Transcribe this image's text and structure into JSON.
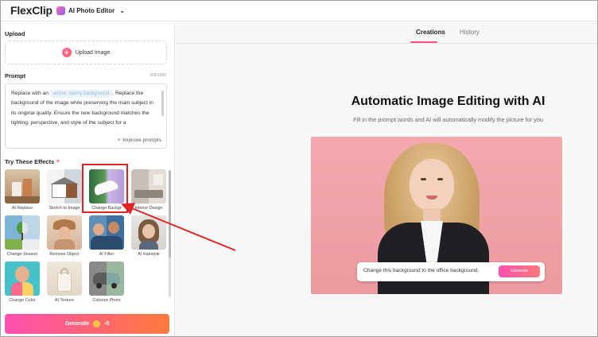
{
  "header": {
    "logo": "FlexClip",
    "tool": "AI Photo Editor"
  },
  "left": {
    "upload_title": "Upload",
    "upload_button": "Upload Image",
    "prompt_title": "Prompt",
    "prompt_counter": "308/1000",
    "prompt_text_before": "Replace with an",
    "prompt_chip": "active, sporty background",
    "prompt_text_after": ". Replace the background of the image while preserving the main subject in its original quality. Ensure the new background matches the lighting, perspective, and style of the subject for a",
    "improve_label": "Improve prompts",
    "effects_title": "Try These Effects",
    "effects": [
      {
        "label": "AI Replace"
      },
      {
        "label": "Sketch to Image"
      },
      {
        "label": "Change Backgr"
      },
      {
        "label": "Interior Design"
      },
      {
        "label": "Change Season"
      },
      {
        "label": "Remove Object"
      },
      {
        "label": "AI Filter"
      },
      {
        "label": "AI Hairstyle"
      },
      {
        "label": "Change Color"
      },
      {
        "label": "AI Texture"
      },
      {
        "label": "Colorize Photo"
      }
    ],
    "generate_label": "Generate",
    "generate_cost": "-5"
  },
  "main": {
    "tabs": [
      {
        "label": "Creations",
        "active": true
      },
      {
        "label": "History",
        "active": false
      }
    ],
    "headline": "Automatic Image Editing with AI",
    "subline": "Fill in the prompt words and AI will automatically modify the picture for you",
    "prompt_pill": "Change this background to the office background.",
    "pill_button": "Generate"
  },
  "colors": {
    "accent": "#ff4d8d",
    "highlight": "#e02424"
  }
}
